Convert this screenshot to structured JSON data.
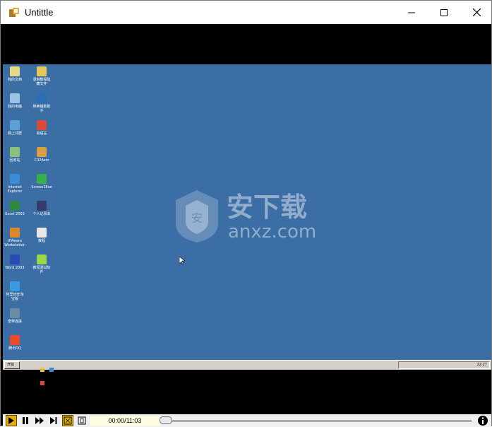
{
  "window": {
    "title": "Untittle",
    "controls": {
      "minimize_icon": "minimize-icon",
      "maximize_icon": "maximize-icon",
      "close_icon": "close-icon"
    }
  },
  "desktop": {
    "background_color": "#3a6ea5",
    "icons": [
      {
        "label": "我的文档",
        "color": "#e8d88a"
      },
      {
        "label": "录制教程隐\n藏文件",
        "color": "#e8c75a"
      },
      {
        "label": "我的电脑",
        "color": "#9cc3e6"
      },
      {
        "label": "棒鼻辅助助\n手",
        "color": "#2a6fb4"
      },
      {
        "label": "网上邻居",
        "color": "#5ca0d8"
      },
      {
        "label": "易语言",
        "color": "#d84a3a"
      },
      {
        "label": "回收站",
        "color": "#8cc07a"
      },
      {
        "label": "C32Asm",
        "color": "#d8a040"
      },
      {
        "label": "Internet\nExplorer",
        "color": "#3a8ad8"
      },
      {
        "label": "Screen2Exe",
        "color": "#3ab04a"
      },
      {
        "label": "Excel 2003",
        "color": "#2e8a3e"
      },
      {
        "label": "个人记事本",
        "color": "#3a3a6a"
      },
      {
        "label": "VMware\nWorkstation",
        "color": "#d88a2a"
      },
      {
        "label": "教程",
        "color": "#e8e8e8"
      },
      {
        "label": "Word 2003",
        "color": "#2a4ab4"
      },
      {
        "label": "教程测试软\n件",
        "color": "#9ad84a"
      },
      {
        "label": "阿里旺旺淘\n宝版",
        "color": "#3a9ae0"
      },
      {
        "label": "",
        "color": ""
      },
      {
        "label": "宽带连接",
        "color": "#6a8aa8"
      },
      {
        "label": "",
        "color": ""
      },
      {
        "label": "腾讯QQ",
        "color": "#e84a2a"
      }
    ],
    "watermark": {
      "text_main": "安下载",
      "text_sub": "anxz.com",
      "shield_char": "安"
    }
  },
  "taskbar": {
    "start_label": "开始",
    "clock": "22:27"
  },
  "player": {
    "play_icon": "play-icon",
    "pause_icon": "pause-icon",
    "fast_forward_icon": "fast-forward-icon",
    "step_icon": "step-forward-icon",
    "fullscreen_icon": "fullscreen-icon",
    "fit_icon": "fit-icon",
    "time_display": "00:00/11:03",
    "progress": 0.0,
    "info_icon": "info-icon"
  }
}
